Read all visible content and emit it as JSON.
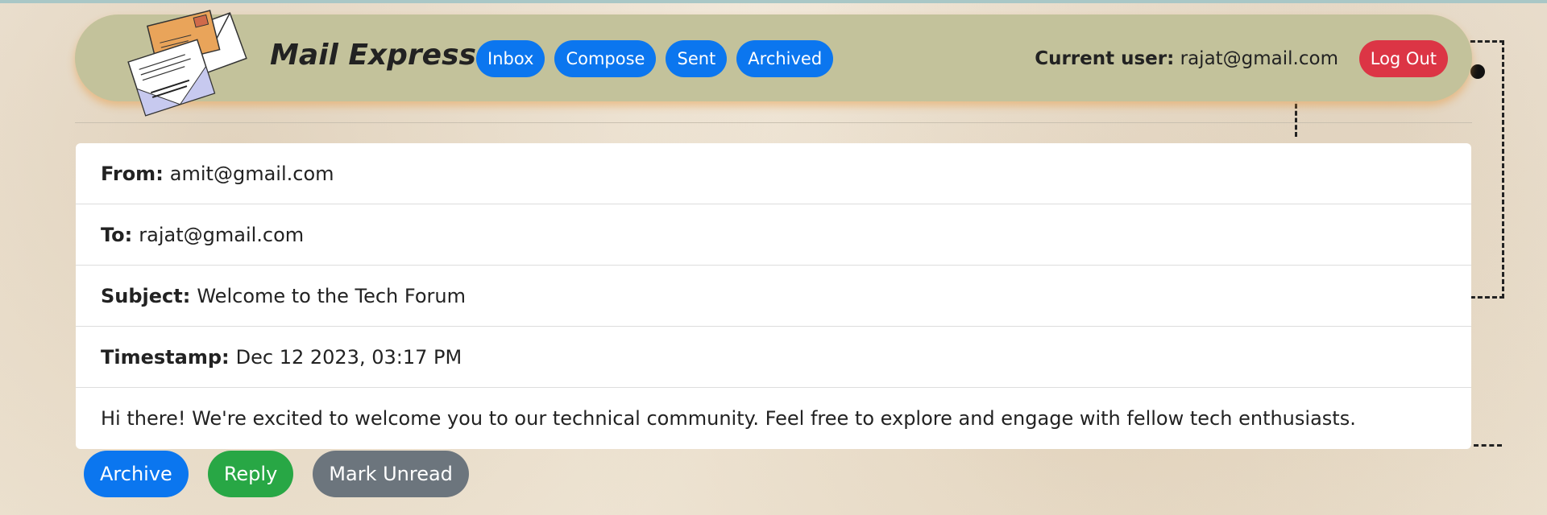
{
  "header": {
    "brand": "Mail Express",
    "nav": [
      {
        "label": "Inbox"
      },
      {
        "label": "Compose"
      },
      {
        "label": "Sent"
      },
      {
        "label": "Archived"
      }
    ],
    "current_user_label": "Current user:",
    "current_user_value": "rajat@gmail.com",
    "logout_label": "Log Out"
  },
  "email": {
    "from_label": "From:",
    "from_value": "amit@gmail.com",
    "to_label": "To:",
    "to_value": "rajat@gmail.com",
    "subject_label": "Subject:",
    "subject_value": "Welcome to the Tech Forum",
    "timestamp_label": "Timestamp:",
    "timestamp_value": "Dec 12 2023, 03:17 PM",
    "body": "Hi there! We're excited to welcome you to our technical community. Feel free to explore and engage with fellow tech enthusiasts."
  },
  "actions": {
    "archive_label": "Archive",
    "reply_label": "Reply",
    "mark_unread_label": "Mark Unread"
  },
  "colors": {
    "header_bg": "#c3c29b",
    "primary": "#0b76ef",
    "danger": "#dc3545",
    "success": "#28a745",
    "secondary": "#6c757d"
  },
  "icons": {
    "logo": "envelopes-logo-icon"
  }
}
